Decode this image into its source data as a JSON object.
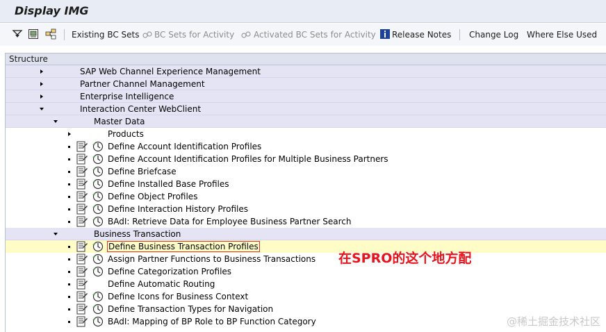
{
  "window": {
    "title": "Display IMG"
  },
  "toolbar": {
    "icons": [
      "expand-all-icon",
      "find-icon",
      "subtree-icon"
    ],
    "existing_bc_sets": "Existing BC Sets",
    "bc_sets_for_activity": "BC Sets for Activity",
    "activated_bc_sets": "Activated BC Sets for Activity",
    "release_notes": "Release Notes",
    "change_log": "Change Log",
    "where_else_used": "Where Else Used"
  },
  "tree": {
    "header": "Structure",
    "rows": [
      {
        "label": "SAP Web Channel Experience Management",
        "node": "collapsed"
      },
      {
        "label": "Partner Channel Management",
        "node": "collapsed"
      },
      {
        "label": "Enterprise Intelligence",
        "node": "collapsed"
      },
      {
        "label": "Interaction Center WebClient",
        "node": "expanded"
      },
      {
        "label": "Master Data",
        "node": "expanded"
      },
      {
        "label": "Products",
        "node": "collapsed"
      },
      {
        "label": "Define Account Identification Profiles",
        "node": "activity"
      },
      {
        "label": "Define Account Identification Profiles for Multiple Business Partners",
        "node": "activity"
      },
      {
        "label": "Define Briefcase",
        "node": "activity"
      },
      {
        "label": "Define Installed Base Profiles",
        "node": "activity"
      },
      {
        "label": "Define Object Profiles",
        "node": "activity"
      },
      {
        "label": "Define Interaction History Profiles",
        "node": "activity"
      },
      {
        "label": "BAdI: Retrieve Data for Employee Business Partner Search",
        "node": "activity"
      },
      {
        "label": "Business Transaction",
        "node": "expanded"
      },
      {
        "label": "Define Business Transaction Profiles",
        "node": "activity",
        "selected": true
      },
      {
        "label": "Assign Partner Functions to Business Transactions",
        "node": "activity"
      },
      {
        "label": "Define Categorization Profiles",
        "node": "activity"
      },
      {
        "label": "Define Automatic Routing",
        "node": "activity"
      },
      {
        "label": "Define Icons for Business Context",
        "node": "activity"
      },
      {
        "label": "Define Transaction Types for Navigation",
        "node": "activity"
      },
      {
        "label": "BAdI: Mapping of BP Role to BP Function Category",
        "node": "activity"
      }
    ]
  },
  "annotation": "在SPRO的这个地方配",
  "watermark": "@稀土掘金技术社区",
  "colors": {
    "annotation": "#e8131b",
    "selection_border": "#e03030",
    "level_background": "#e5e4f5"
  }
}
